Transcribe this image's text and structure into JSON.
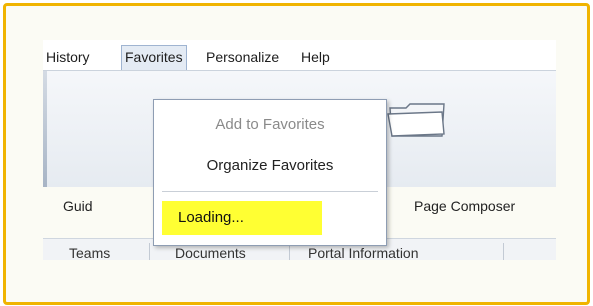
{
  "menubar": {
    "items": [
      {
        "label": "History"
      },
      {
        "label": "Favorites"
      },
      {
        "label": "Personalize"
      },
      {
        "label": "Help"
      }
    ]
  },
  "ribbon": {
    "left_label": "Guid",
    "right_label": "Page Composer"
  },
  "tabs": [
    {
      "label": "Teams"
    },
    {
      "label": "Documents"
    },
    {
      "label": "Portal Information"
    }
  ],
  "favorites_menu": {
    "add_label": "Add to Favorites",
    "organize_label": "Organize Favorites",
    "loading_label": "Loading..."
  },
  "colors": {
    "frame": "#f0b400",
    "highlight": "#ffff33"
  }
}
